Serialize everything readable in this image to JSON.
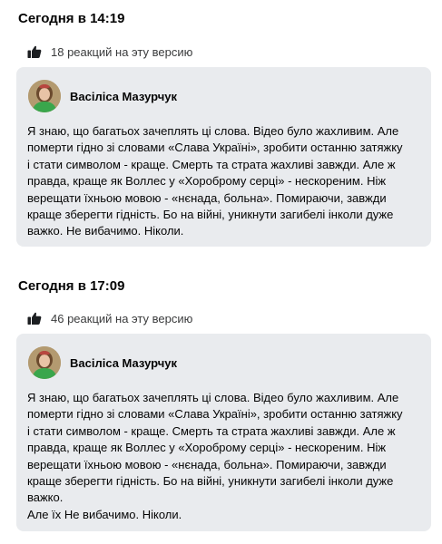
{
  "versions": [
    {
      "timestamp": "Сегодня в 14:19",
      "reactions": "18 реакций на эту версию",
      "author": "Васіліса Мазурчук",
      "text": "Я знаю, що багатьох зачеплять ці слова. Відео було жахливим. Але\nпомерти гідно зі словами «Слава Україні», зробити останню затяжку\nі стати символом - краще. Смерть та страта жахливі завжди. Але ж\nправда, краще як Воллес у «Хороброму серці» - нескореним. Ніж\nверещати їхньою мовою - «нєнада, больна». Помираючи, завжди\nкраще зберегти гідність. Бо на війні, уникнути загибелі інколи дуже\nважко. Не вибачимо. Ніколи."
    },
    {
      "timestamp": "Сегодня в 17:09",
      "reactions": "46 реакций на эту версию",
      "author": "Васіліса Мазурчук",
      "text": "Я знаю, що багатьох зачеплять ці слова. Відео було жахливим. Але\nпомерти гідно зі словами «Слава Україні», зробити останню затяжку\nі стати символом - краще. Смерть та страта жахливі завжди. Але ж\nправда, краще як Воллес у «Хороброму серці» - нескореним. Ніж\nверещати їхньою мовою - «нєнада, больна». Помираючи, завжди\nкраще зберегти гідність. Бо на війні, уникнути загибелі інколи дуже\nважко.\nАле їх Не вибачимо. Ніколи."
    }
  ],
  "icons": {
    "reaction": "thumbs-up-icon",
    "avatar": "user-avatar"
  }
}
